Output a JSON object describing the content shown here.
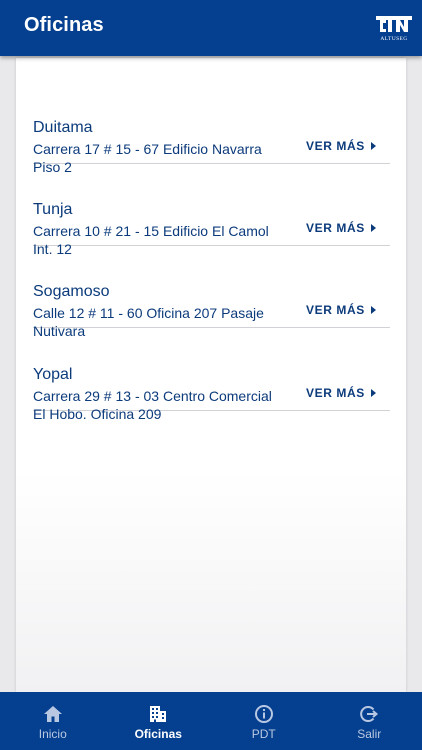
{
  "header": {
    "title": "Oficinas",
    "logo_text": "CJN",
    "logo_subtext": "ALTUSEG"
  },
  "offices": [
    {
      "name": "Duitama",
      "address": "Carrera 17 # 15 - 67 Edificio Navarra Piso 2",
      "more": "VER MÁS"
    },
    {
      "name": "Tunja",
      "address": "Carrera 10 # 21 - 15 Edificio El Camol Int. 12",
      "more": "VER MÁS"
    },
    {
      "name": "Sogamoso",
      "address": "Calle 12 # 11 - 60 Oficina 207 Pasaje Nutivara",
      "more": "VER MÁS"
    },
    {
      "name": "Yopal",
      "address": "Carrera 29 # 13 - 03 Centro Comercial El Hobo. Oficina 209",
      "more": "VER MÁS"
    }
  ],
  "nav": [
    {
      "label": "Inicio",
      "icon": "home-icon",
      "active": false
    },
    {
      "label": "Oficinas",
      "icon": "building-icon",
      "active": true
    },
    {
      "label": "PDT",
      "icon": "info-icon",
      "active": false
    },
    {
      "label": "Salir",
      "icon": "logout-icon",
      "active": false
    }
  ],
  "colors": {
    "primary": "#053f8f",
    "text": "#0c3b7c",
    "nav_inactive": "#b9c8e2"
  }
}
